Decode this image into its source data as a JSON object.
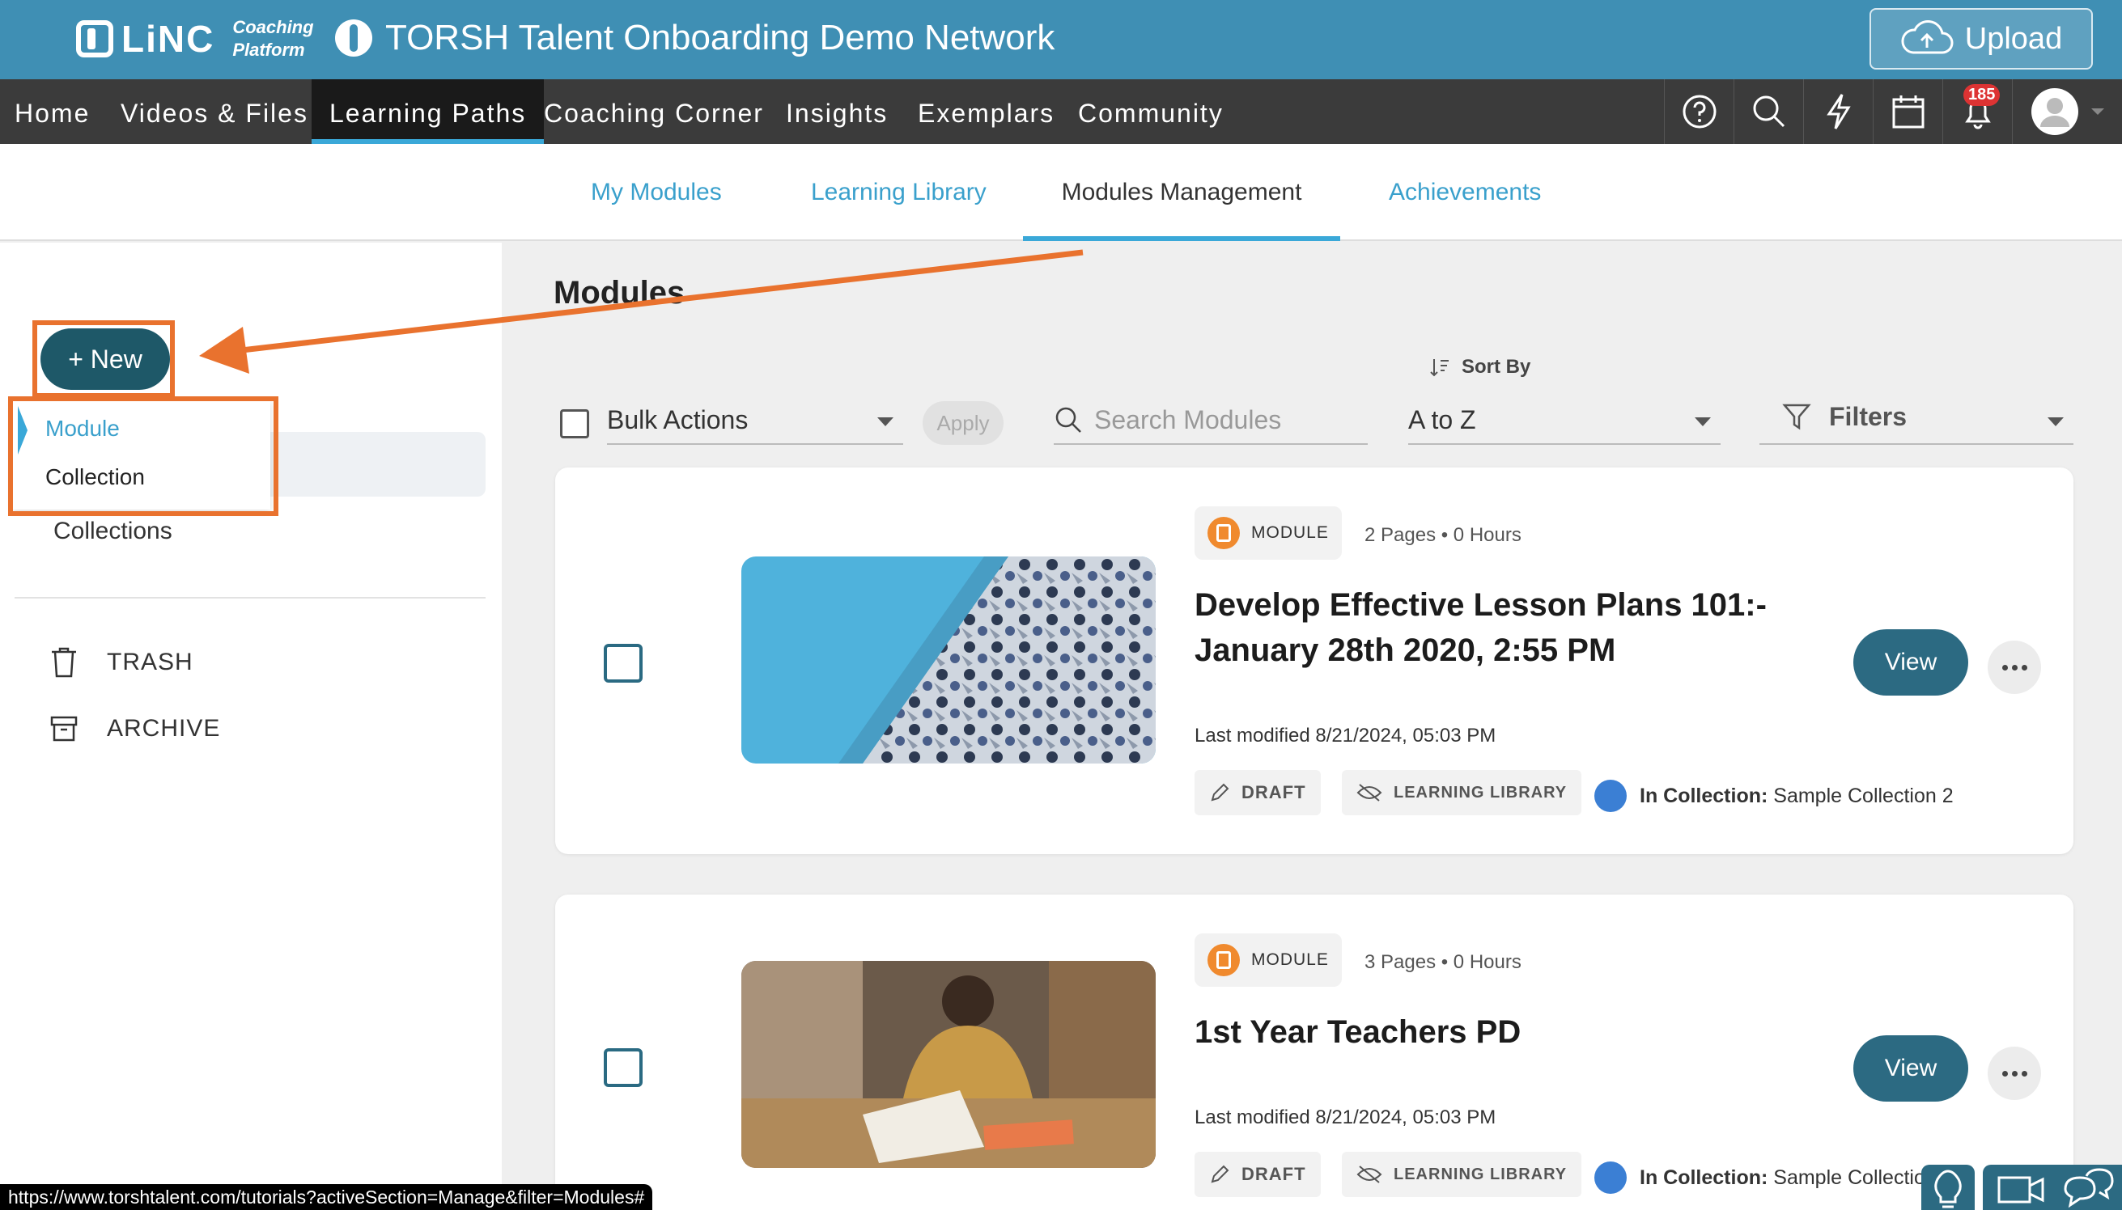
{
  "header": {
    "logo_text": "LiNC",
    "logo_sub_1": "Coaching",
    "logo_sub_2": "Platform",
    "network_name": "TORSH Talent Onboarding Demo Network",
    "upload_label": "Upload"
  },
  "nav": {
    "items": [
      "Home",
      "Videos & Files",
      "Learning Paths",
      "Coaching Corner",
      "Insights",
      "Exemplars",
      "Community"
    ],
    "active": "Learning Paths",
    "notification_count": "185",
    "icons": [
      "help-icon",
      "search-icon",
      "lightning-icon",
      "calendar-icon",
      "bell-icon",
      "avatar-icon"
    ]
  },
  "subtabs": {
    "items": [
      "My Modules",
      "Learning Library",
      "Modules Management",
      "Achievements"
    ],
    "active": "Modules Management"
  },
  "sidebar": {
    "new_label": "+ New",
    "dropdown": [
      "Module",
      "Collection"
    ],
    "collections_label": "Collections",
    "trash_label": "TRASH",
    "archive_label": "ARCHIVE"
  },
  "main": {
    "title": "Modules",
    "sort_by_label": "Sort By",
    "bulk_actions_label": "Bulk Actions",
    "apply_label": "Apply",
    "search_placeholder": "Search Modules",
    "sort_value": "A to Z",
    "filters_label": "Filters"
  },
  "cards": [
    {
      "type_label": "MODULE",
      "meta": "2 Pages • 0 Hours",
      "title_line1": "Develop Effective Lesson Plans 101:-",
      "title_line2": "January 28th 2020, 2:55 PM",
      "modified": "Last modified 8/21/2024, 05:03 PM",
      "status_tag": "DRAFT",
      "library_tag": "LEARNING LIBRARY",
      "collection_prefix": "In Collection:",
      "collection_name": "Sample Collection 2",
      "view_label": "View"
    },
    {
      "type_label": "MODULE",
      "meta": "3 Pages • 0 Hours",
      "title_line1": "1st Year Teachers PD",
      "title_line2": "",
      "modified": "Last modified 8/21/2024, 05:03 PM",
      "status_tag": "DRAFT",
      "library_tag": "LEARNING LIBRARY",
      "collection_prefix": "In Collection:",
      "collection_name": "Sample Collectio",
      "view_label": "View"
    }
  ],
  "status_url": "https://www.torshtalent.com/tutorials?activeSection=Manage&filter=Modules#",
  "colors": {
    "header_blue": "#3f8fb4",
    "nav_dark": "#3b3b3b",
    "accent_blue": "#3aa8d8",
    "highlight_orange": "#e9722e",
    "button_teal": "#2c6a82",
    "module_orange": "#f08a2e"
  }
}
